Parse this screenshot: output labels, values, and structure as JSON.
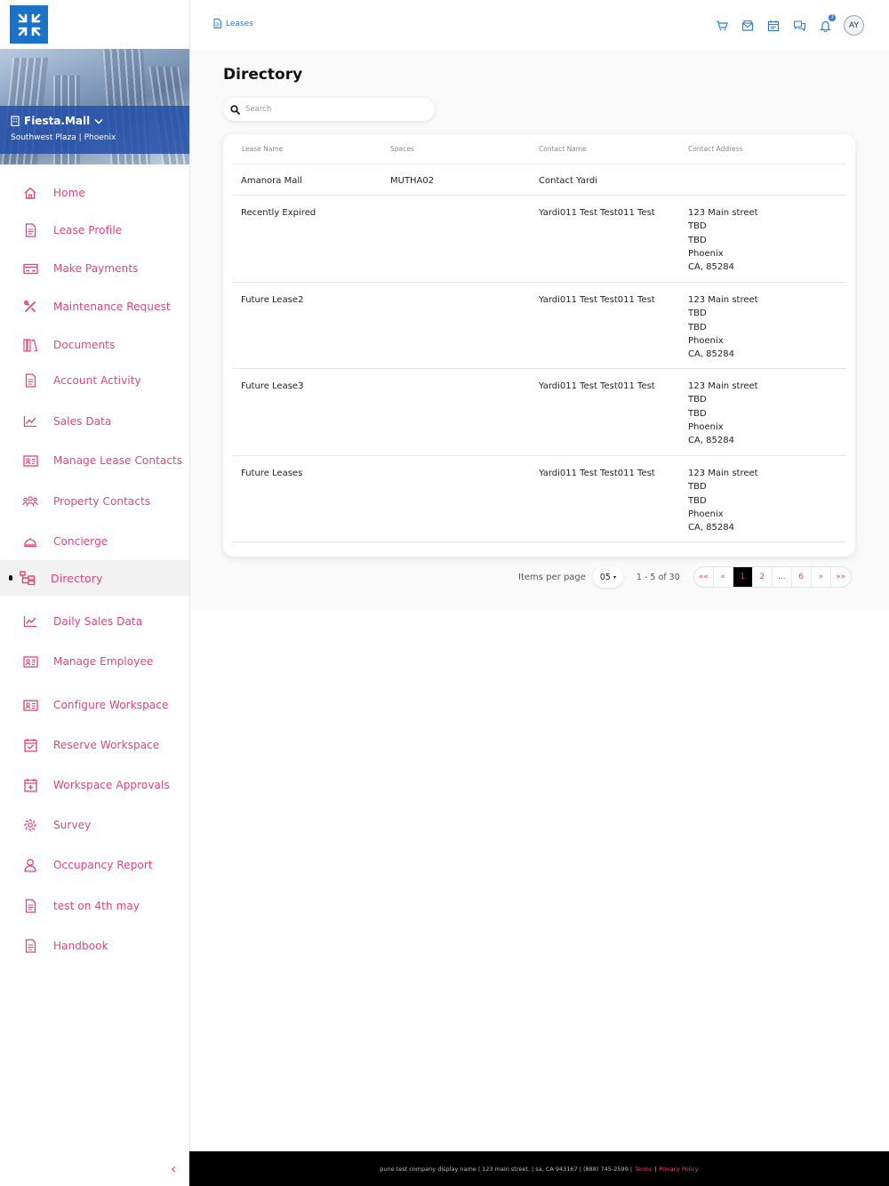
{
  "property": {
    "name": "Fiesta.Mall",
    "subtitle": "Southwest Plaza | Phoenix"
  },
  "breadcrumb": {
    "label": "Leases"
  },
  "user": {
    "initials": "AY",
    "notification_count": "3"
  },
  "nav": [
    {
      "label": "Home",
      "icon": "home-icon"
    },
    {
      "label": "Lease Profile",
      "icon": "document-icon"
    },
    {
      "label": "Make Payments",
      "icon": "credit-card-icon"
    },
    {
      "label": "Maintenance Request",
      "icon": "tools-icon"
    },
    {
      "label": "Documents",
      "icon": "books-icon"
    },
    {
      "label": "Account Activity",
      "icon": "document-icon"
    },
    {
      "label": "Sales Data",
      "icon": "chart-icon"
    },
    {
      "label": "Manage Lease Contacts",
      "icon": "id-card-icon"
    },
    {
      "label": "Property Contacts",
      "icon": "people-icon"
    },
    {
      "label": "Concierge",
      "icon": "bell-icon"
    },
    {
      "label": "Directory",
      "icon": "directory-icon",
      "active": true
    },
    {
      "label": "Daily Sales Data",
      "icon": "chart-icon"
    },
    {
      "label": "Manage Employee",
      "icon": "id-card-icon"
    },
    {
      "label": "Configure Workspace",
      "icon": "id-card-icon"
    },
    {
      "label": "Reserve Workspace",
      "icon": "calendar-check-icon"
    },
    {
      "label": "Workspace Approvals",
      "icon": "calendar-plus-icon"
    },
    {
      "label": "Survey",
      "icon": "gear-icon"
    },
    {
      "label": "Occupancy Report",
      "icon": "user-icon"
    },
    {
      "label": "test on 4th may",
      "icon": "document-icon"
    },
    {
      "label": "Handbook",
      "icon": "document-icon"
    }
  ],
  "page": {
    "title": "Directory",
    "search_placeholder": "Search"
  },
  "table": {
    "headers": [
      "Lease Name",
      "Spaces",
      "Contact Name",
      "Contact Address"
    ],
    "rows": [
      {
        "lease": "Amanora Mall",
        "spaces": "MUTHA02",
        "contact": "Contact Yardi",
        "address": ""
      },
      {
        "lease": "Recently Expired",
        "spaces": "",
        "contact": "Yardi011 Test Test011 Test",
        "address": "123 Main street\nTBD\nTBD\nPhoenix\nCA, 85284"
      },
      {
        "lease": "Future Lease2",
        "spaces": "",
        "contact": "Yardi011 Test Test011 Test",
        "address": "123 Main street\nTBD\nTBD\nPhoenix\nCA, 85284"
      },
      {
        "lease": "Future Lease3",
        "spaces": "",
        "contact": "Yardi011 Test Test011 Test",
        "address": "123 Main street\nTBD\nTBD\nPhoenix\nCA, 85284"
      },
      {
        "lease": "Future Leases",
        "spaces": "",
        "contact": "Yardi011 Test Test011 Test",
        "address": "123 Main street\nTBD\nTBD\nPhoenix\nCA, 85284"
      }
    ]
  },
  "pagination": {
    "items_per_page_label": "Items per page",
    "items_per_page": "05",
    "range": "1 - 5 of 30",
    "first": "««",
    "prev": "«",
    "pages": [
      "1",
      "2",
      "...",
      "6"
    ],
    "current": "1",
    "next": "»",
    "last": "»»"
  },
  "footer": {
    "text": "pune test company display name | 123 main street. | sa, CA 943167 | (888) 745-2599 |",
    "terms": "Terms",
    "separator": "|",
    "privacy": "Privacy Policy"
  },
  "colors": {
    "accent": "#e0457b",
    "brand_blue": "#1a73c8",
    "link_blue": "#2f7bd3"
  }
}
